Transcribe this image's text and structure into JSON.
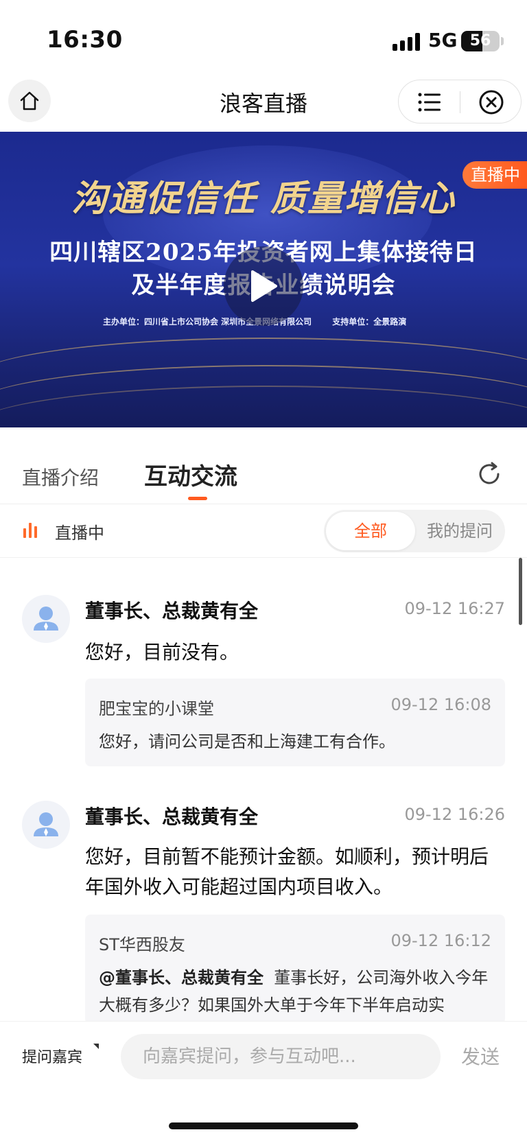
{
  "status_bar": {
    "time": "16:30",
    "network": "5G",
    "battery": "56",
    "battery_level_percent": 56
  },
  "nav": {
    "title": "浪客直播",
    "icons": [
      "home-icon",
      "menu-list-icon",
      "close-circle-icon"
    ]
  },
  "banner": {
    "headline": "沟通促信任 质量增信心",
    "line1": "四川辖区2025年投资者网上集体接待日",
    "line2": "及半年度报告业绩说明会",
    "organizer": "主办单位：四川省上市公司协会  深圳市全景网络有限公司",
    "support": "支持单位：全景路演",
    "live_badge": "直播中",
    "colors": {
      "background": "#1f2d95",
      "headline": "#f2d48e",
      "badge": "#ff5a1f"
    }
  },
  "tabs": {
    "intro": "直播介绍",
    "interact": "互动交流",
    "active": "互动交流"
  },
  "live_bar": {
    "status": "直播中",
    "filter_all": "全部",
    "filter_mine": "我的提问"
  },
  "messages": [
    {
      "sender": "董事长、总裁黄有全",
      "time": "09-12 16:27",
      "answer": "您好，目前没有。",
      "question": {
        "user": "肥宝宝的小课堂",
        "time": "09-12 16:08",
        "mention": "",
        "text": "您好，请问公司是否和上海建工有合作。"
      }
    },
    {
      "sender": "董事长、总裁黄有全",
      "time": "09-12 16:26",
      "answer": "您好，目前暂不能预计金额。如顺利，预计明后年国外收入可能超过国内项目收入。",
      "question": {
        "user": "ST华西股友",
        "time": "09-12 16:12",
        "mention": "@董事长、总裁黄有全",
        "text": "董事长好，公司海外收入今年大概有多少？如果国外大单于今年下半年启动实"
      }
    }
  ],
  "input_bar": {
    "ask_guest": "提问嘉宾",
    "placeholder": "向嘉宾提问，参与互动吧...",
    "send": "发送"
  },
  "accent_color": "#ff5a1f"
}
